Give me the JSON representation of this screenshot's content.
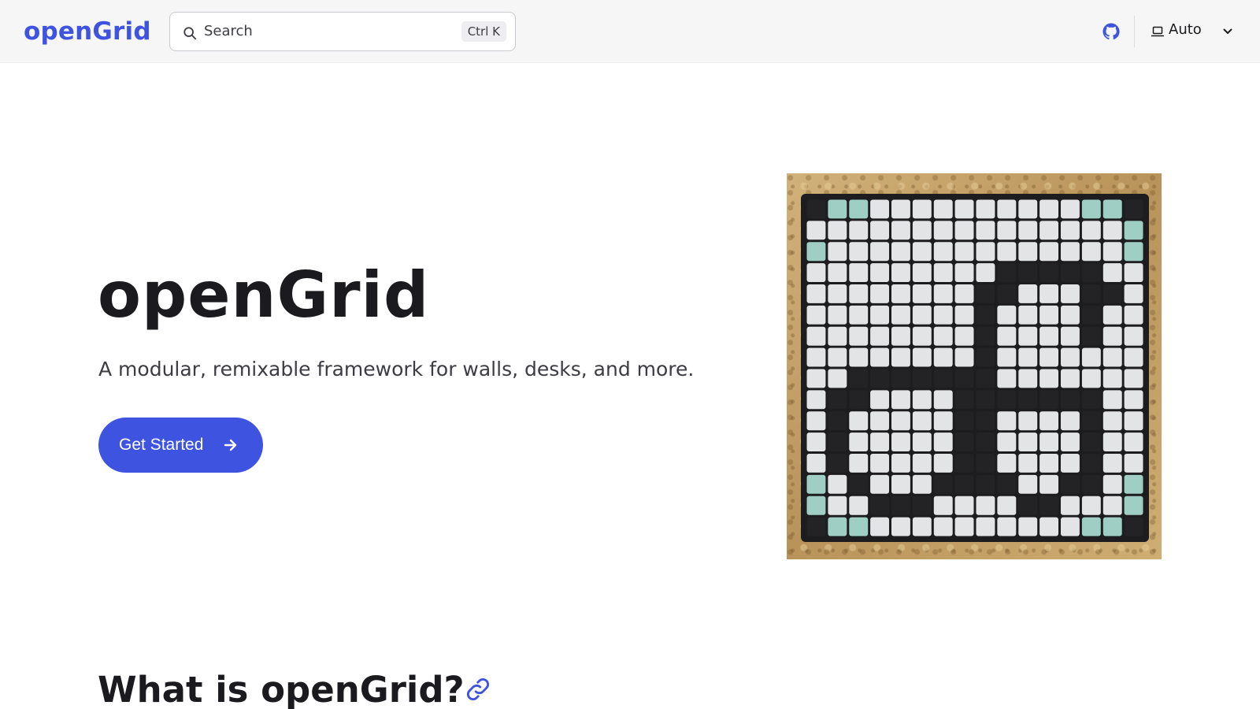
{
  "header": {
    "brand": "openGrid",
    "search": {
      "placeholder": "Search",
      "shortcut": "Ctrl K",
      "icon": "search-icon"
    },
    "github_icon": "github-icon",
    "theme": {
      "label": "Auto",
      "icon": "laptop-icon",
      "dropdown_icon": "chevron-down-icon"
    }
  },
  "hero": {
    "title": "openGrid",
    "tagline": "A modular, remixable framework for walls, desks, and more.",
    "cta_label": "Get Started",
    "cta_icon": "arrow-right-icon",
    "image": {
      "description_icon": "opengrid-photo",
      "grid": {
        "rows": 16,
        "cols": 16,
        "dark_cells": [
          [
            0,
            0
          ],
          [
            0,
            15
          ],
          [
            3,
            9
          ],
          [
            3,
            10
          ],
          [
            3,
            11
          ],
          [
            3,
            12
          ],
          [
            3,
            13
          ],
          [
            4,
            8
          ],
          [
            4,
            9
          ],
          [
            4,
            13
          ],
          [
            4,
            14
          ],
          [
            5,
            8
          ],
          [
            5,
            13
          ],
          [
            6,
            8
          ],
          [
            6,
            13
          ],
          [
            7,
            8
          ],
          [
            8,
            2
          ],
          [
            8,
            3
          ],
          [
            8,
            4
          ],
          [
            8,
            5
          ],
          [
            8,
            6
          ],
          [
            8,
            7
          ],
          [
            8,
            8
          ],
          [
            9,
            1
          ],
          [
            9,
            2
          ],
          [
            9,
            7
          ],
          [
            9,
            8
          ],
          [
            9,
            9
          ],
          [
            9,
            10
          ],
          [
            9,
            11
          ],
          [
            9,
            12
          ],
          [
            9,
            13
          ],
          [
            10,
            1
          ],
          [
            10,
            7
          ],
          [
            10,
            8
          ],
          [
            10,
            13
          ],
          [
            11,
            1
          ],
          [
            11,
            7
          ],
          [
            11,
            8
          ],
          [
            11,
            13
          ],
          [
            12,
            1
          ],
          [
            12,
            7
          ],
          [
            12,
            8
          ],
          [
            12,
            13
          ],
          [
            13,
            2
          ],
          [
            13,
            6
          ],
          [
            13,
            7
          ],
          [
            13,
            8
          ],
          [
            13,
            9
          ],
          [
            13,
            12
          ],
          [
            13,
            13
          ],
          [
            14,
            3
          ],
          [
            14,
            4
          ],
          [
            14,
            5
          ],
          [
            14,
            10
          ],
          [
            14,
            11
          ],
          [
            15,
            0
          ],
          [
            15,
            15
          ]
        ],
        "teal_cells": [
          [
            0,
            1
          ],
          [
            0,
            2
          ],
          [
            0,
            13
          ],
          [
            0,
            14
          ],
          [
            1,
            15
          ],
          [
            2,
            0
          ],
          [
            2,
            15
          ],
          [
            13,
            0
          ],
          [
            13,
            15
          ],
          [
            14,
            0
          ],
          [
            14,
            15
          ],
          [
            15,
            1
          ],
          [
            15,
            2
          ],
          [
            15,
            13
          ],
          [
            15,
            14
          ]
        ]
      }
    }
  },
  "section": {
    "title": "What is openGrid?",
    "anchor_icon": "link-icon"
  },
  "colors": {
    "brand": "#3e54e0",
    "text": "#1b1b1f",
    "header_bg": "#f6f6f7"
  }
}
